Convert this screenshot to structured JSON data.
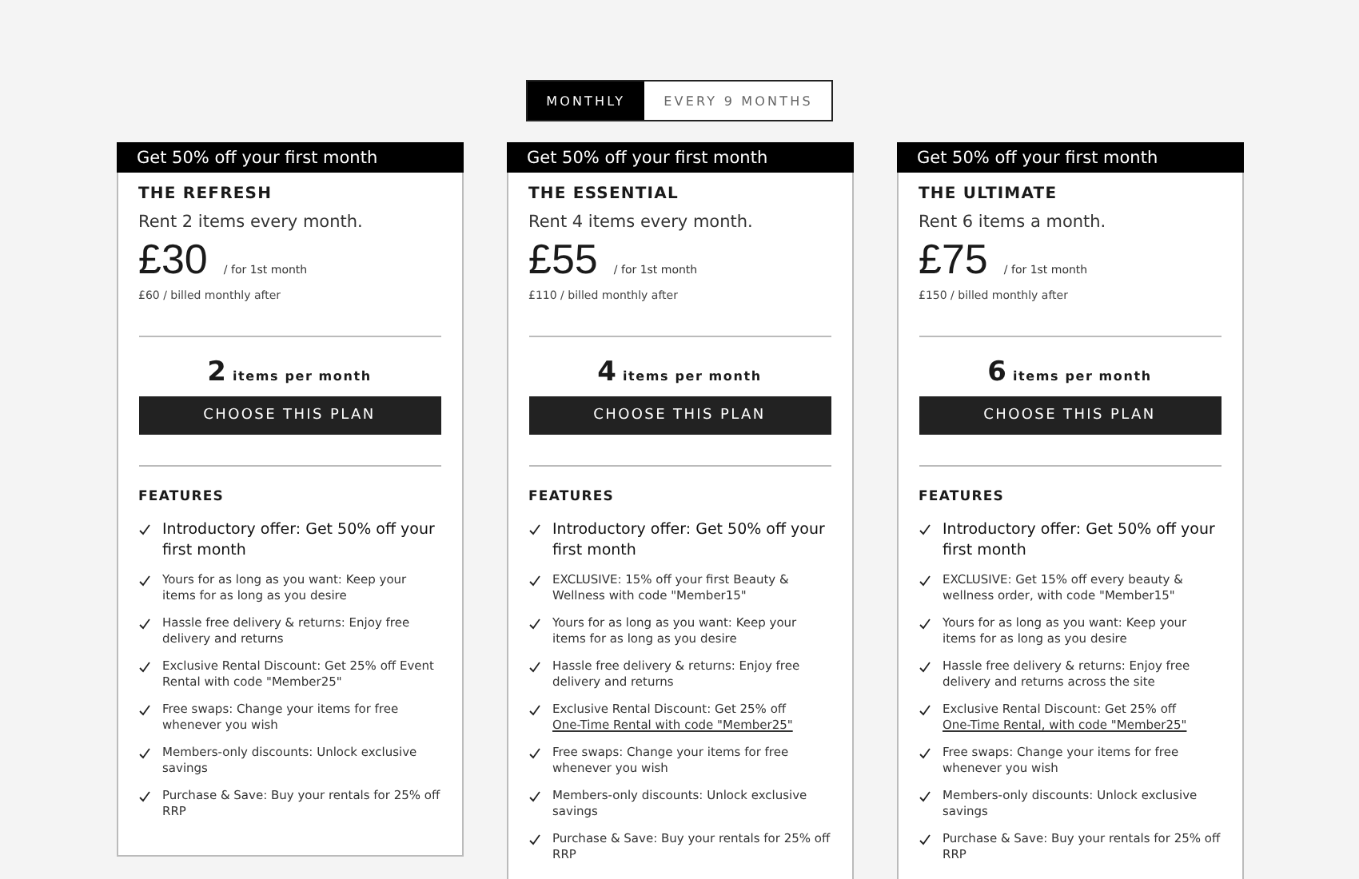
{
  "billing_toggle": [
    {
      "label": "MONTHLY",
      "selected": true
    },
    {
      "label": "EVERY 9 MONTHS",
      "selected": false
    }
  ],
  "plans": [
    {
      "banner": "Get 50% off your first month",
      "name": "THE REFRESH",
      "subtitle": "Rent 2 items every month.",
      "price": "£30",
      "price_note": "/ for 1st month",
      "after": "£60 / billed monthly after",
      "items_count": "2",
      "items_label": "items per month",
      "button": "CHOOSE THIS PLAN",
      "features_title": "FEATURES",
      "features": [
        {
          "kind": "highlight",
          "text": "Introductory offer: Get 50% off your first month"
        },
        {
          "kind": "plain",
          "text": "Yours for as long as you want: Keep your items for as long as you desire"
        },
        {
          "kind": "plain",
          "text": "Hassle free delivery & returns: Enjoy free delivery and returns"
        },
        {
          "kind": "plain",
          "text": "Exclusive Rental Discount: Get 25% off Event Rental with code \"Member25\""
        },
        {
          "kind": "plain",
          "text": "Free swaps: Change your items for free whenever you wish"
        },
        {
          "kind": "plain",
          "text": "Members-only discounts: Unlock exclusive savings"
        },
        {
          "kind": "plain",
          "text": "Purchase & Save: Buy your rentals for 25% off RRP"
        }
      ]
    },
    {
      "banner": "Get 50% off your first month",
      "name": "THE ESSENTIAL",
      "subtitle": "Rent 4 items every month.",
      "price": "£55",
      "price_note": "/ for 1st month",
      "after": "£110 / billed monthly after",
      "items_count": "4",
      "items_label": "items per month",
      "button": "CHOOSE THIS PLAN",
      "features_title": "FEATURES",
      "features": [
        {
          "kind": "highlight",
          "text": "Introductory offer: Get 50% off your first month"
        },
        {
          "kind": "plain",
          "text": "EXCLUSIVE: 15% off your first Beauty & Wellness with code \"Member15\""
        },
        {
          "kind": "plain",
          "text": "Yours for as long as you want: Keep your items for as long as you desire"
        },
        {
          "kind": "plain",
          "text": "Hassle free delivery & returns: Enjoy free delivery and returns"
        },
        {
          "kind": "plain",
          "text": "Exclusive Rental Discount: Get 25% off",
          "link": "One-Time Rental with code \"Member25\""
        },
        {
          "kind": "plain",
          "text": "Free swaps: Change your items for free whenever you wish"
        },
        {
          "kind": "plain",
          "text": "Members-only discounts: Unlock exclusive savings"
        },
        {
          "kind": "plain",
          "text": "Purchase & Save: Buy your rentals for 25% off RRP"
        }
      ]
    },
    {
      "banner": "Get 50% off your first month",
      "name": "THE ULTIMATE",
      "subtitle": "Rent 6 items a month.",
      "price": "£75",
      "price_note": "/ for 1st month",
      "after": "£150 / billed monthly after",
      "items_count": "6",
      "items_label": "items per month",
      "button": "CHOOSE THIS PLAN",
      "features_title": "FEATURES",
      "features": [
        {
          "kind": "highlight",
          "text": "Introductory offer: Get 50% off your first month"
        },
        {
          "kind": "plain",
          "text": "EXCLUSIVE: Get 15% off every beauty & wellness order, with code \"Member15\""
        },
        {
          "kind": "plain",
          "text": "Yours for as long as you want: Keep your items for as long as you desire"
        },
        {
          "kind": "plain",
          "text": "Hassle free delivery & returns: Enjoy free delivery and returns across the site"
        },
        {
          "kind": "plain",
          "text": "Exclusive Rental Discount: Get 25% off",
          "link": "One-Time Rental, with code \"Member25\""
        },
        {
          "kind": "plain",
          "text": "Free swaps: Change your items for free whenever you wish"
        },
        {
          "kind": "plain",
          "text": "Members-only discounts: Unlock exclusive savings"
        },
        {
          "kind": "plain",
          "text": "Purchase & Save: Buy your rentals for 25% off RRP"
        }
      ]
    }
  ]
}
